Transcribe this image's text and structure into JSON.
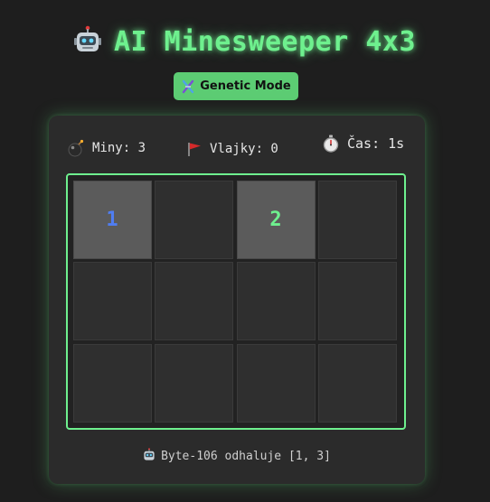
{
  "title": "AI Minesweeper 4x3",
  "mode_button": {
    "label": "Genetic Mode"
  },
  "stats": {
    "mines_label": "Miny: 3",
    "flags_label": "Vlajky: 0",
    "time_label": "Čas: 1s"
  },
  "board": {
    "rows": 3,
    "cols": 4,
    "cells": [
      [
        {
          "state": "revealed",
          "value": "1",
          "color": "#4f7df2"
        },
        {
          "state": "hidden",
          "value": ""
        },
        {
          "state": "revealed",
          "value": "2",
          "color": "#6ef08e"
        },
        {
          "state": "hidden",
          "value": ""
        }
      ],
      [
        {
          "state": "hidden",
          "value": ""
        },
        {
          "state": "hidden",
          "value": ""
        },
        {
          "state": "hidden",
          "value": ""
        },
        {
          "state": "hidden",
          "value": ""
        }
      ],
      [
        {
          "state": "hidden",
          "value": ""
        },
        {
          "state": "hidden",
          "value": ""
        },
        {
          "state": "hidden",
          "value": ""
        },
        {
          "state": "hidden",
          "value": ""
        }
      ]
    ]
  },
  "status_text": "Byte-106 odhaluje [1, 3]",
  "icons": {
    "title": "robot-icon",
    "mode": "dna-icon",
    "mines": "bomb-icon",
    "flags": "flag-icon",
    "time": "stopwatch-icon",
    "status": "robot-icon"
  },
  "colors": {
    "accent": "#6ef08e",
    "button": "#5ccc73",
    "background": "#1e1e1e",
    "panel": "#2b2b2b"
  }
}
